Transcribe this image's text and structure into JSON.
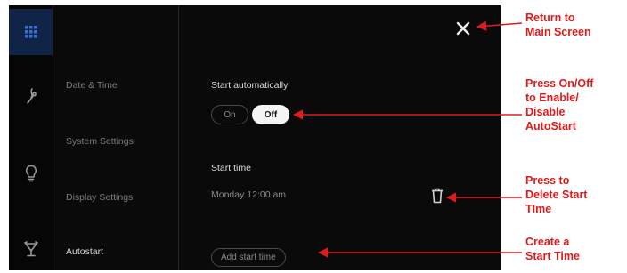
{
  "sidebar": {
    "menu": [
      {
        "label": "Date & Time"
      },
      {
        "label": "System Settings"
      },
      {
        "label": "Display Settings"
      },
      {
        "label": "Autostart"
      }
    ]
  },
  "icons": [
    "grid-icon",
    "cooking-icon",
    "bulb-icon",
    "lamp-icon",
    "close-icon",
    "trash-icon"
  ],
  "content": {
    "start_auto_label": "Start automatically",
    "toggle_on": "On",
    "toggle_off": "Off",
    "toggle_selected": "Off",
    "start_time_label": "Start time",
    "start_time_value": "Monday 12:00 am",
    "add_button": "Add start time"
  },
  "annotations": {
    "color": "#e01b1b",
    "return": [
      "Return to",
      "Main Screen"
    ],
    "toggle": [
      "Press On/Off",
      "to Enable/",
      "Disable",
      "AutoStart"
    ],
    "delete": [
      "Press to",
      "Delete Start",
      "TIme"
    ],
    "create": [
      "Create a",
      "Start Time"
    ]
  },
  "colors": {
    "screen_bg": "#0a0a0a",
    "active_rail": "#0f2446",
    "active_icon": "#3b6fd8"
  }
}
